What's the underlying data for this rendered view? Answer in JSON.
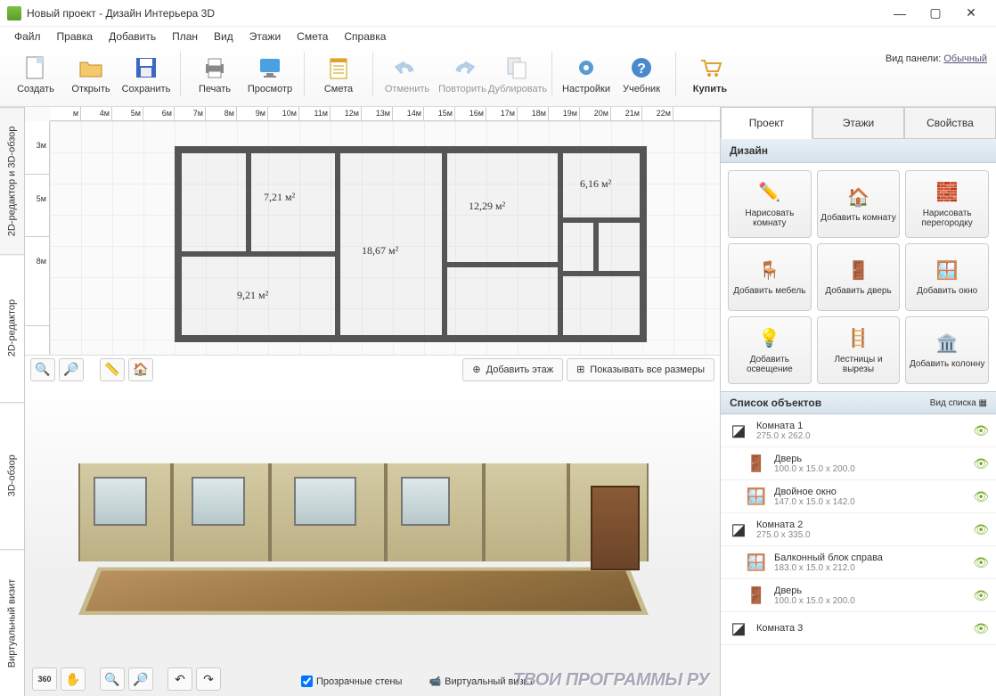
{
  "window": {
    "title": "Новый проект - Дизайн Интерьера 3D"
  },
  "menu": [
    "Файл",
    "Правка",
    "Добавить",
    "План",
    "Вид",
    "Этажи",
    "Смета",
    "Справка"
  ],
  "toolbar": {
    "create": "Создать",
    "open": "Открыть",
    "save": "Сохранить",
    "print": "Печать",
    "preview": "Просмотр",
    "estimate": "Смета",
    "undo": "Отменить",
    "redo": "Повторить",
    "duplicate": "Дублировать",
    "settings": "Настройки",
    "tutorial": "Учебник",
    "buy": "Купить"
  },
  "panelinfo": {
    "label": "Вид панели:",
    "value": "Обычный"
  },
  "vtabs": {
    "combo": "2D-редактор и 3D-обзор",
    "editor": "2D-редактор",
    "view3d": "3D-обзор",
    "virtual": "Виртуальный визит"
  },
  "ruler_h": [
    "м",
    "4м",
    "5м",
    "6м",
    "7м",
    "8м",
    "9м",
    "10м",
    "11м",
    "12м",
    "13м",
    "14м",
    "15м",
    "16м",
    "17м",
    "18м",
    "19м",
    "20м",
    "21м",
    "22м"
  ],
  "ruler_v": [
    "3м",
    "5м",
    "8м"
  ],
  "rooms": {
    "r1": "7,21 м²",
    "r2": "18,67 м²",
    "r3": "12,29 м²",
    "r4": "6,16 м²",
    "r5": "9,21 м²"
  },
  "plantools": {
    "addfloor": "Добавить этаж",
    "showsizes": "Показывать все размеры"
  },
  "view3d": {
    "transparent": "Прозрачные стены",
    "camera": "Виртуальный визит"
  },
  "rtabs": {
    "project": "Проект",
    "floors": "Этажи",
    "props": "Свойства"
  },
  "design_title": "Дизайн",
  "design": [
    "Нарисовать комнату",
    "Добавить комнату",
    "Нарисовать перегородку",
    "Добавить мебель",
    "Добавить дверь",
    "Добавить окно",
    "Добавить освещение",
    "Лестницы и вырезы",
    "Добавить колонну"
  ],
  "objlist_title": "Список объектов",
  "objlist_viewlabel": "Вид списка",
  "objects": [
    {
      "name": "Комната 1",
      "dim": "275.0 x 262.0",
      "child": false,
      "icon": "room"
    },
    {
      "name": "Дверь",
      "dim": "100.0 x 15.0 x 200.0",
      "child": true,
      "icon": "door"
    },
    {
      "name": "Двойное окно",
      "dim": "147.0 x 15.0 x 142.0",
      "child": true,
      "icon": "window"
    },
    {
      "name": "Комната 2",
      "dim": "275.0 x 335.0",
      "child": false,
      "icon": "room"
    },
    {
      "name": "Балконный блок справа",
      "dim": "183.0 x 15.0 x 212.0",
      "child": true,
      "icon": "window"
    },
    {
      "name": "Дверь",
      "dim": "100.0 x 15.0 x 200.0",
      "child": true,
      "icon": "door"
    },
    {
      "name": "Комната 3",
      "dim": "",
      "child": false,
      "icon": "room"
    }
  ],
  "watermark": "ТВОИ ПРОГРАММЫ РУ"
}
